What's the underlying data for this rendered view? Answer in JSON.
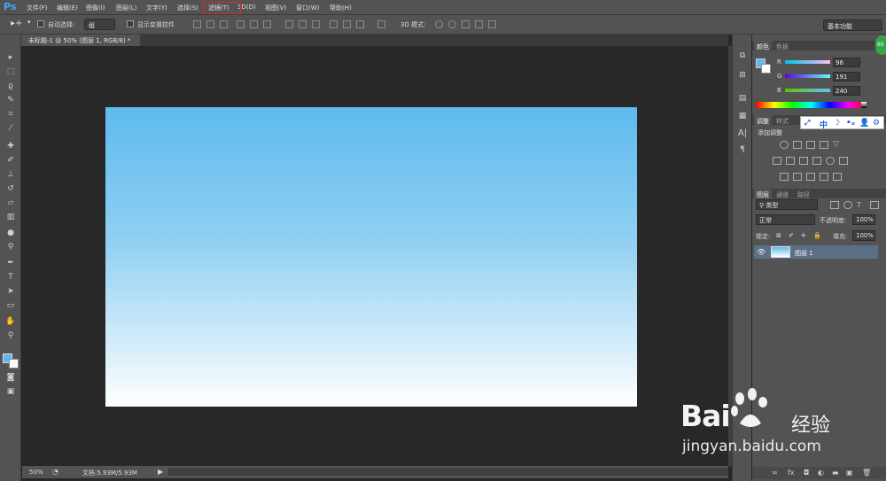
{
  "app": {
    "logo": "Ps"
  },
  "menu": [
    {
      "label": "文件(F)"
    },
    {
      "label": "编辑(E)"
    },
    {
      "label": "图像(I)"
    },
    {
      "label": "图层(L)"
    },
    {
      "label": "文字(Y)"
    },
    {
      "label": "选择(S)"
    },
    {
      "label": "滤镜(T)"
    },
    {
      "label": "3D(D)"
    },
    {
      "label": "视图(V)"
    },
    {
      "label": "窗口(W)"
    },
    {
      "label": "帮助(H)"
    }
  ],
  "options": {
    "auto_select_label": "自动选择:",
    "auto_select_value": "组",
    "show_transform_label": "显示变换控件",
    "mode_3d_label": "3D 模式:",
    "workspace": "基本功能"
  },
  "document": {
    "tab_title": "未标题-1 @ 50% (图层 1, RGB/8) *",
    "zoom": "50%",
    "doc_size": "文档:5.93M/5.93M"
  },
  "color_panel": {
    "tabs": [
      "颜色",
      "色板"
    ],
    "fg_color": "#5ebaee",
    "channels": [
      {
        "label": "R",
        "value": "96"
      },
      {
        "label": "G",
        "value": "191"
      },
      {
        "label": "B",
        "value": "240"
      }
    ]
  },
  "adjust_panel": {
    "tabs": [
      "调整",
      "样式"
    ],
    "title": "添加调整",
    "popup_icons": [
      "中",
      "☽",
      "•ₒ",
      "👤",
      "⚙"
    ]
  },
  "layers_panel": {
    "tabs": [
      "图层",
      "通道",
      "路径"
    ],
    "filter": "类型",
    "blend_mode": "正常",
    "opacity_label": "不透明度:",
    "opacity_value": "100%",
    "lock_label": "锁定:",
    "fill_label": "填充:",
    "fill_value": "100%",
    "layers": [
      {
        "name": "图层 1"
      }
    ]
  },
  "badge": "65",
  "watermark": {
    "brand": "Bai",
    "brand_cn": "经验",
    "url": "jingyan.baidu.com"
  },
  "colors": {
    "accent_highlight": "#e0262d",
    "canvas_top": "#5ebaee",
    "canvas_bottom": "#ffffff",
    "selected_layer": "#5b6f86"
  }
}
